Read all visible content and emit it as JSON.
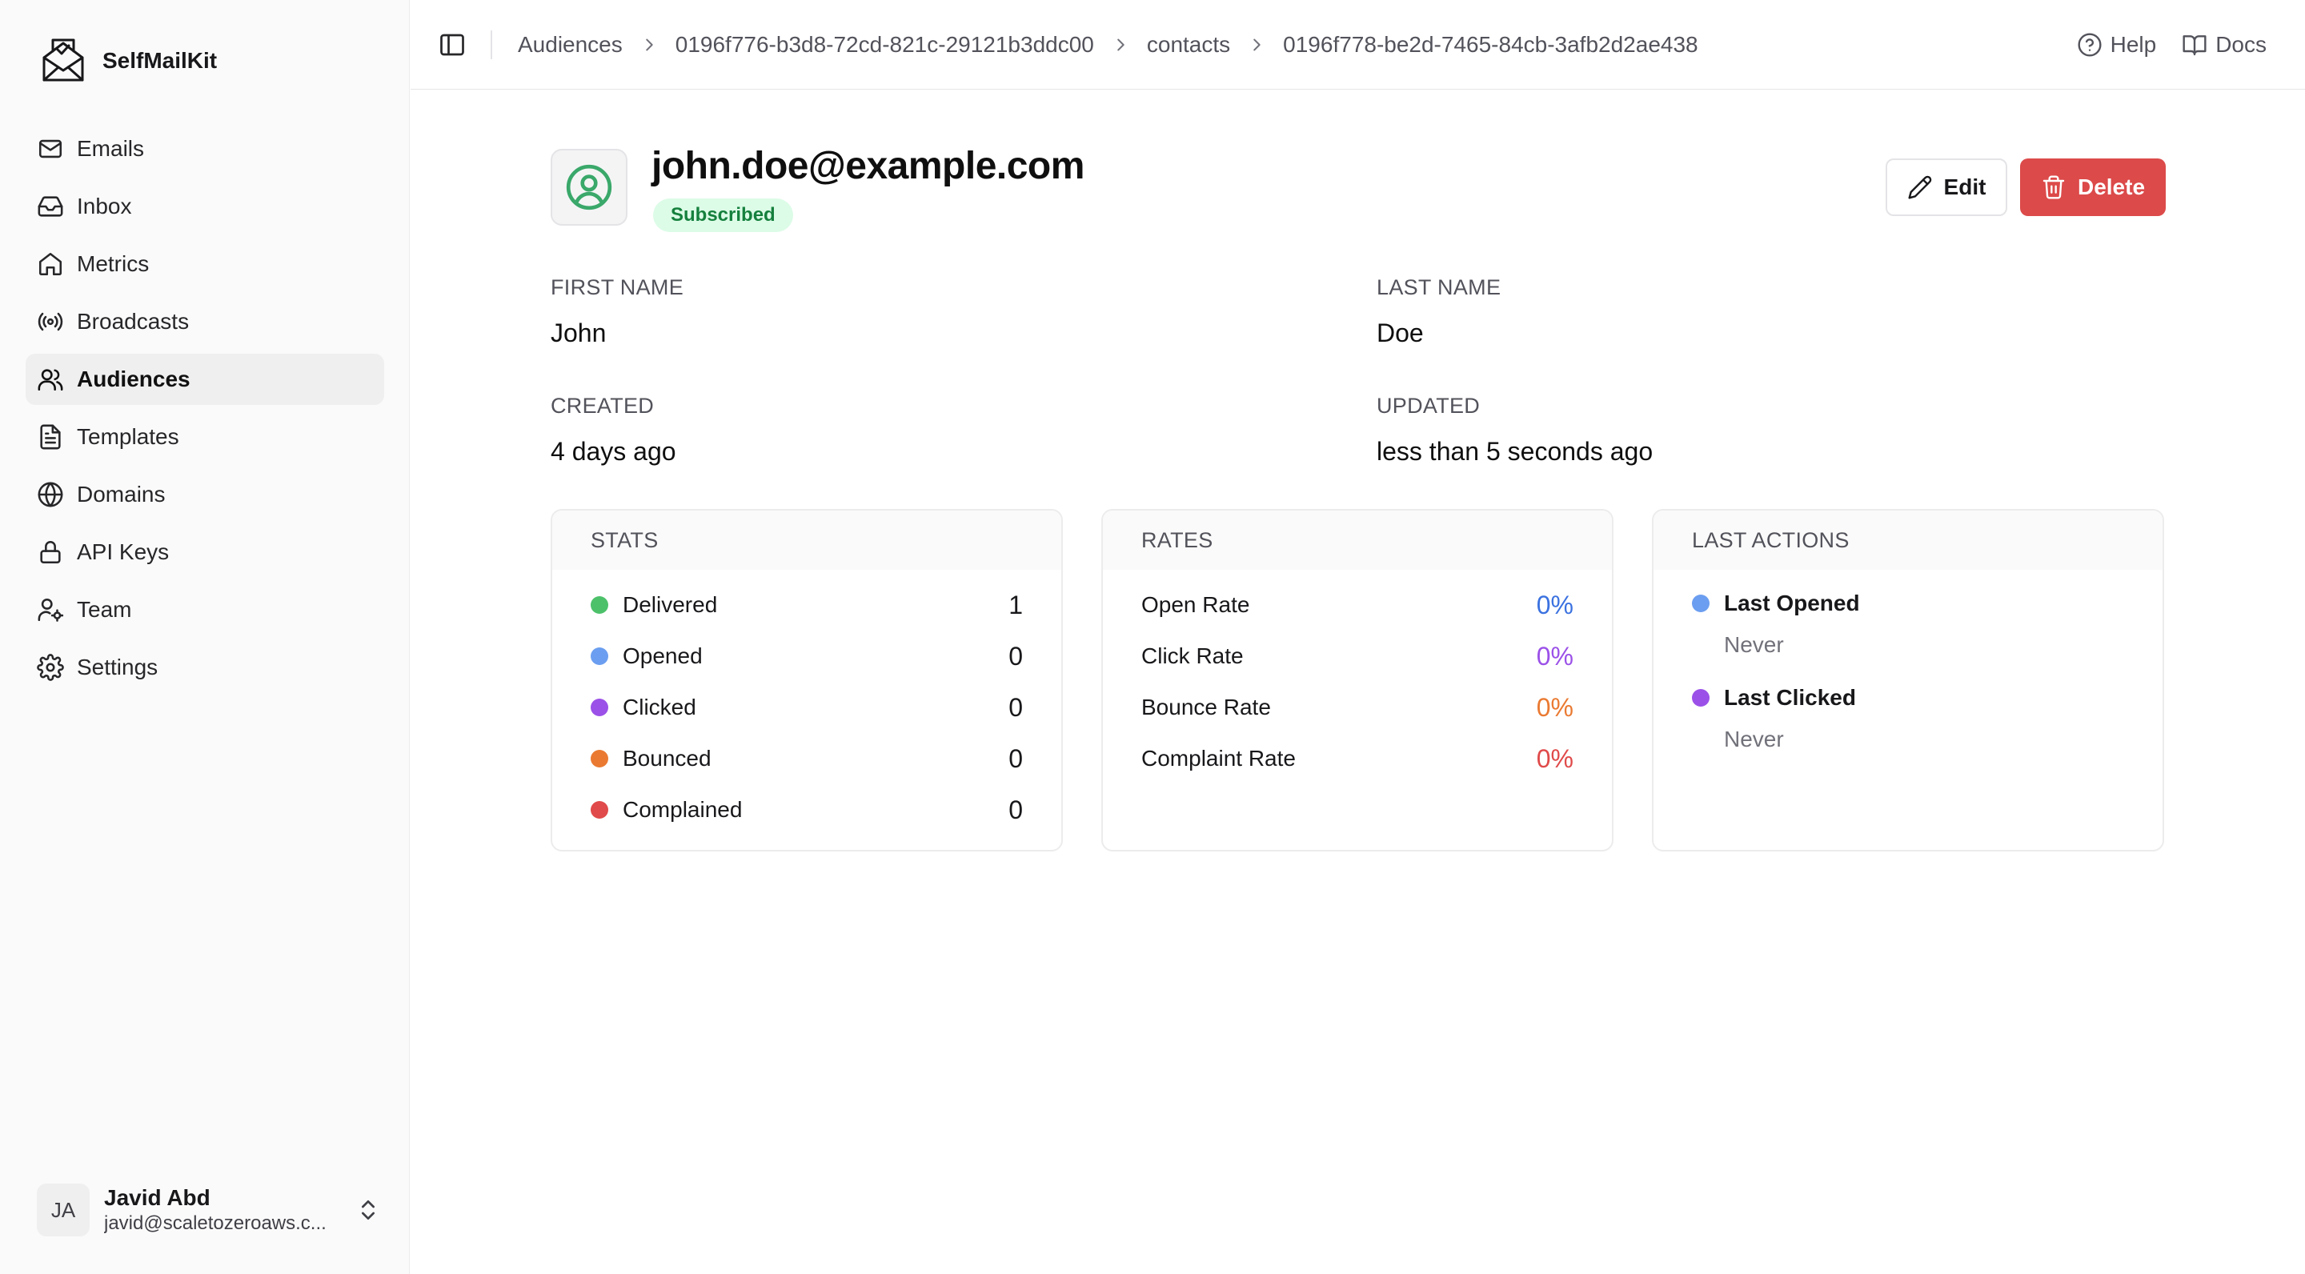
{
  "app": {
    "name": "SelfMailKit"
  },
  "sidebar": {
    "items": [
      {
        "label": "Emails",
        "icon": "mail-icon",
        "active": false
      },
      {
        "label": "Inbox",
        "icon": "inbox-icon",
        "active": false
      },
      {
        "label": "Metrics",
        "icon": "home-icon",
        "active": false
      },
      {
        "label": "Broadcasts",
        "icon": "broadcast-icon",
        "active": false
      },
      {
        "label": "Audiences",
        "icon": "users-icon",
        "active": true
      },
      {
        "label": "Templates",
        "icon": "file-text-icon",
        "active": false
      },
      {
        "label": "Domains",
        "icon": "globe-icon",
        "active": false
      },
      {
        "label": "API Keys",
        "icon": "lock-icon",
        "active": false
      },
      {
        "label": "Team",
        "icon": "user-cog-icon",
        "active": false
      },
      {
        "label": "Settings",
        "icon": "gear-icon",
        "active": false
      }
    ],
    "user": {
      "initials": "JA",
      "name": "Javid Abd",
      "email": "javid@scaletozeroaws.c..."
    }
  },
  "header": {
    "breadcrumb": [
      "Audiences",
      "0196f776-b3d8-72cd-821c-29121b3ddc00",
      "contacts",
      "0196f778-be2d-7465-84cb-3afb2d2ae438"
    ],
    "help_label": "Help",
    "docs_label": "Docs"
  },
  "contact": {
    "email": "john.doe@example.com",
    "status": "Subscribed",
    "edit_label": "Edit",
    "delete_label": "Delete",
    "fields": {
      "first_name_label": "FIRST NAME",
      "first_name": "John",
      "last_name_label": "LAST NAME",
      "last_name": "Doe",
      "created_label": "CREATED",
      "created": "4 days ago",
      "updated_label": "UPDATED",
      "updated": "less than 5 seconds ago"
    }
  },
  "stats": {
    "title": "STATS",
    "rows": [
      {
        "label": "Delivered",
        "value": "1",
        "color": "#4cc16a"
      },
      {
        "label": "Opened",
        "value": "0",
        "color": "#6b9ef0"
      },
      {
        "label": "Clicked",
        "value": "0",
        "color": "#9b51e8"
      },
      {
        "label": "Bounced",
        "value": "0",
        "color": "#ea7a32"
      },
      {
        "label": "Complained",
        "value": "0",
        "color": "#e04a4a"
      }
    ]
  },
  "rates": {
    "title": "RATES",
    "rows": [
      {
        "label": "Open Rate",
        "value": "0%",
        "color": "#3b72e0"
      },
      {
        "label": "Click Rate",
        "value": "0%",
        "color": "#9b51e8"
      },
      {
        "label": "Bounce Rate",
        "value": "0%",
        "color": "#ea7a32"
      },
      {
        "label": "Complaint Rate",
        "value": "0%",
        "color": "#e04a4a"
      }
    ]
  },
  "last_actions": {
    "title": "LAST ACTIONS",
    "items": [
      {
        "label": "Last Opened",
        "value": "Never",
        "color": "#6b9ef0"
      },
      {
        "label": "Last Clicked",
        "value": "Never",
        "color": "#9b51e8"
      }
    ]
  },
  "colors": {
    "accent_danger": "#dc4a4a",
    "badge_bg": "#dcfce7",
    "badge_text": "#15803d",
    "contact_icon": "#3aa86a"
  }
}
